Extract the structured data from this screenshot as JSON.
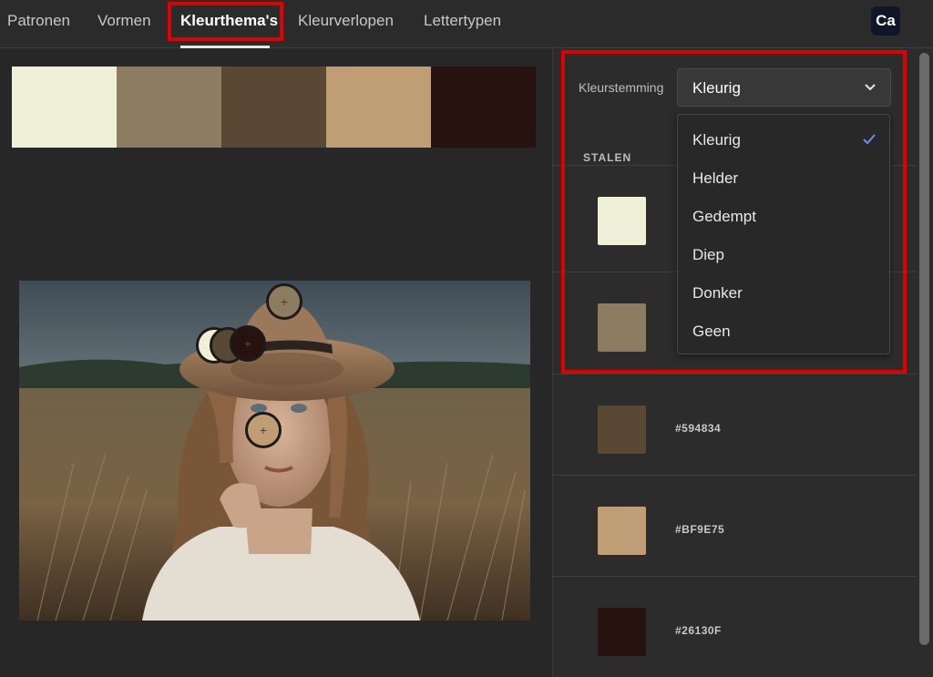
{
  "tabs": [
    {
      "label": "Patronen"
    },
    {
      "label": "Vormen"
    },
    {
      "label": "Kleurthema's"
    },
    {
      "label": "Kleurverlopen"
    },
    {
      "label": "Lettertypen"
    }
  ],
  "active_tab": "Kleurthema's",
  "app_badge": "Ca",
  "palette": [
    "#F0F0D8",
    "#8C7D62",
    "#594834",
    "#BF9E75",
    "#26130F"
  ],
  "panel": {
    "mood_label": "Kleurstemming",
    "mood_value": "Kleurig",
    "stalen_label": "STALEN",
    "swatches": [
      {
        "color": "#F0F0D8",
        "hex": ""
      },
      {
        "color": "#8C7D62",
        "hex": ""
      },
      {
        "color": "#594834",
        "hex": "#594834"
      },
      {
        "color": "#BF9E75",
        "hex": "#BF9E75"
      },
      {
        "color": "#26130F",
        "hex": "#26130F"
      }
    ]
  },
  "dropdown": {
    "options": [
      "Kleurig",
      "Helder",
      "Gedempt",
      "Diep",
      "Donker",
      "Geen"
    ],
    "selected": "Kleurig"
  },
  "colors": {
    "highlight": "#E00000",
    "check": "#6E8EF0"
  },
  "icons": {
    "chevron": "chevron-down-icon",
    "check": "checkmark-icon",
    "picker": "plus-icon"
  }
}
